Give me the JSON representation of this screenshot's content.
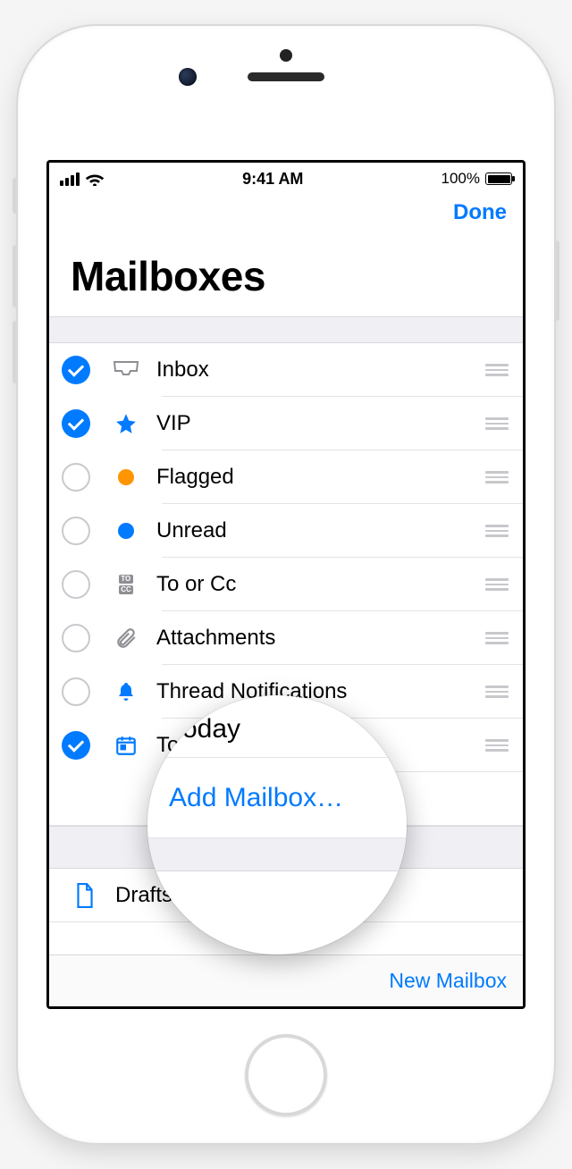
{
  "status": {
    "time": "9:41 AM",
    "battery_pct": "100%"
  },
  "nav": {
    "done": "Done"
  },
  "title": "Mailboxes",
  "mailboxes": [
    {
      "label": "Inbox",
      "checked": true,
      "icon": "inbox"
    },
    {
      "label": "VIP",
      "checked": true,
      "icon": "star"
    },
    {
      "label": "Flagged",
      "checked": false,
      "icon": "dot-orange"
    },
    {
      "label": "Unread",
      "checked": false,
      "icon": "dot-blue"
    },
    {
      "label": "To or Cc",
      "checked": false,
      "icon": "tocc"
    },
    {
      "label": "Attachments",
      "checked": false,
      "icon": "paperclip"
    },
    {
      "label": "Thread Notifications",
      "checked": false,
      "icon": "bell"
    },
    {
      "label": "Today",
      "checked": true,
      "icon": "calendar"
    }
  ],
  "add_mailbox": "Add Mailbox…",
  "accounts": [
    {
      "label": "Drafts",
      "icon": "draft"
    }
  ],
  "lens": {
    "top_label": "Today",
    "link_label": "Add Mailbox…"
  },
  "footer": {
    "new_mailbox": "New Mailbox"
  },
  "colors": {
    "accent": "#007aff",
    "flag_orange": "#ff9500"
  }
}
